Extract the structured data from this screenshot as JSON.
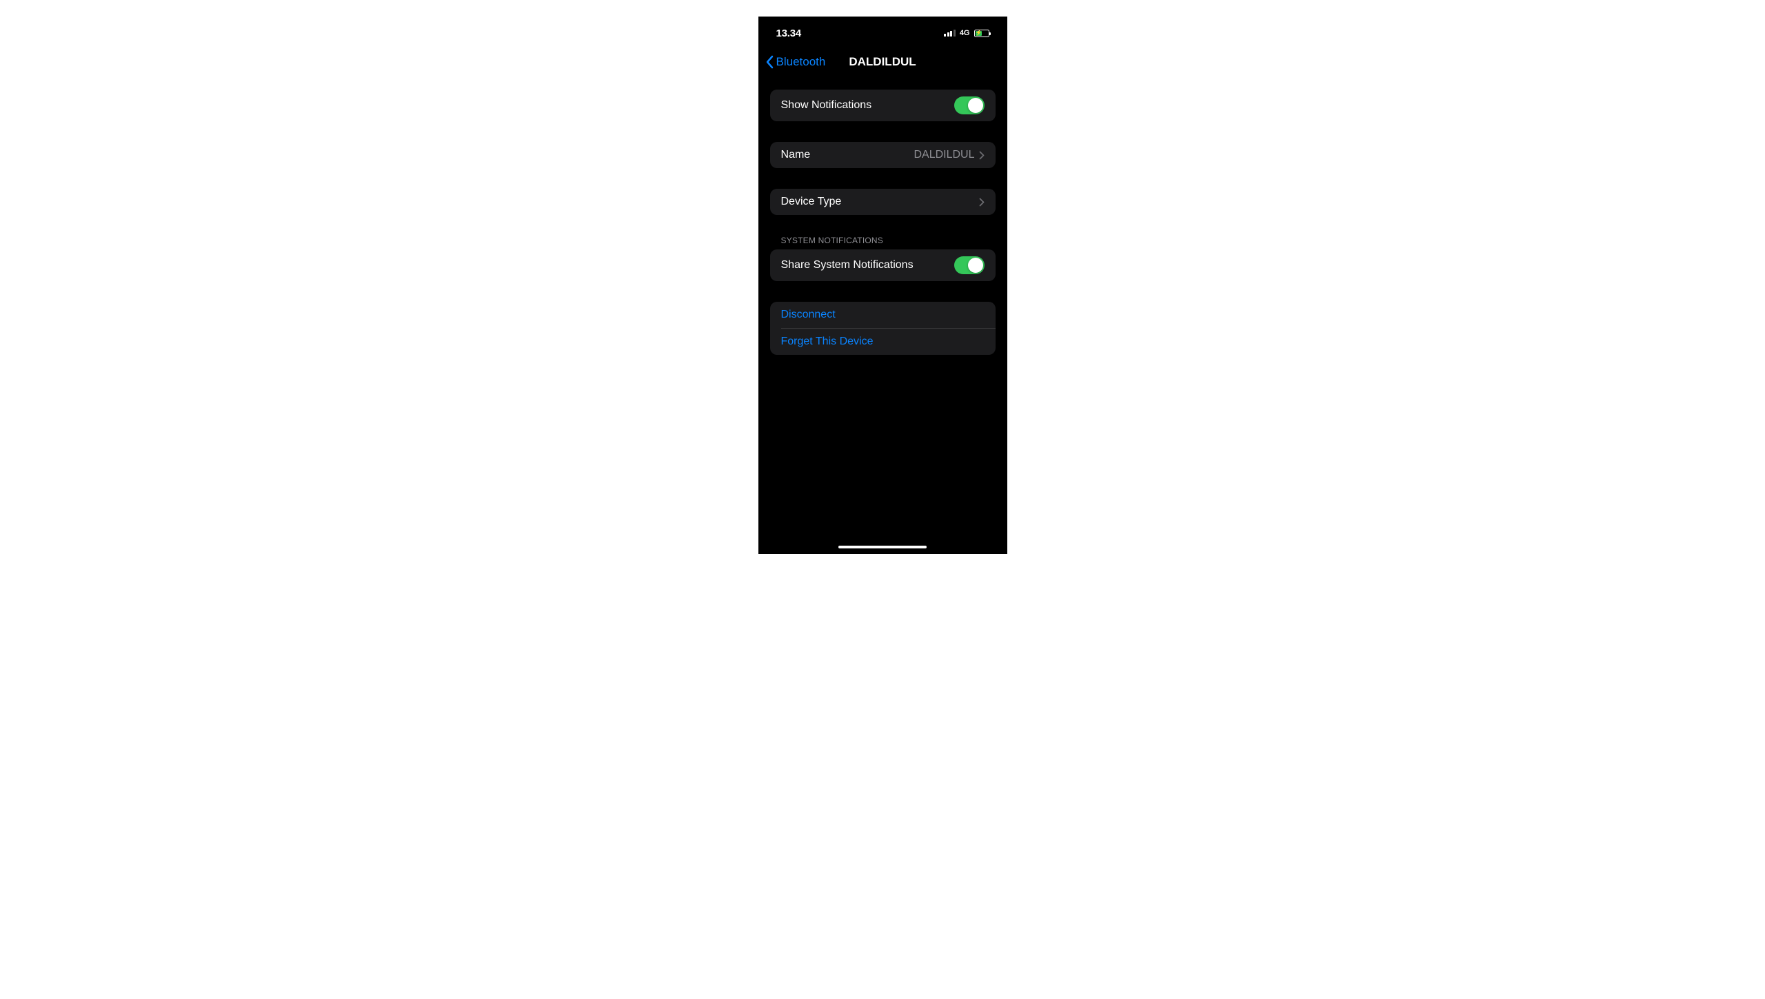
{
  "status_bar": {
    "time": "13.34",
    "network": "4G"
  },
  "nav": {
    "back_label": "Bluetooth",
    "title": "DALDILDUL"
  },
  "sections": {
    "show_notifications": {
      "label": "Show Notifications",
      "enabled": true
    },
    "name_row": {
      "label": "Name",
      "value": "DALDILDUL"
    },
    "device_type": {
      "label": "Device Type"
    },
    "system_notifications_header": "System Notifications",
    "share_system_notifications": {
      "label": "Share System Notifications",
      "enabled": true
    },
    "disconnect": {
      "label": "Disconnect"
    },
    "forget": {
      "label": "Forget This Device"
    }
  }
}
